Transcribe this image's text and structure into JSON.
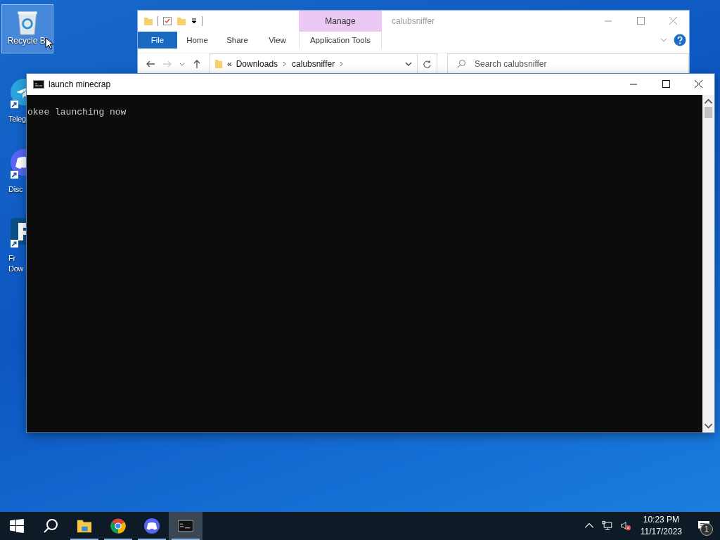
{
  "desktop_icons": [
    {
      "kind": "recycle",
      "lines": [
        "Recycle Bi"
      ],
      "selected": true
    },
    {
      "kind": "telegram",
      "lines": [
        "Teleg"
      ],
      "selected": false
    },
    {
      "kind": "discord",
      "lines": [
        "Disc"
      ],
      "selected": false
    },
    {
      "kind": "letter-app",
      "lines": [
        "Fr",
        "Dow"
      ],
      "selected": false
    }
  ],
  "explorer": {
    "title": "calubsniffer",
    "context_tab": "Manage",
    "ribbon_tabs": [
      {
        "label": "File",
        "kind": "file"
      },
      {
        "label": "Home",
        "kind": "plain"
      },
      {
        "label": "Share",
        "kind": "plain"
      },
      {
        "label": "View",
        "kind": "plain"
      },
      {
        "label": "Application Tools",
        "kind": "context"
      }
    ],
    "address": {
      "overflow": "«",
      "crumbs": [
        "Downloads",
        "calubsniffer"
      ]
    },
    "search": {
      "placeholder": "Search calubsniffer"
    }
  },
  "console": {
    "title": "launch minecrap",
    "lines": [
      "okee launching now"
    ]
  },
  "taskbar": {
    "apps": [
      {
        "kind": "start",
        "running": false,
        "selected": false
      },
      {
        "kind": "search",
        "running": false,
        "selected": false
      },
      {
        "kind": "explorer",
        "running": true,
        "selected": false
      },
      {
        "kind": "chrome",
        "running": true,
        "selected": false
      },
      {
        "kind": "discord",
        "running": true,
        "selected": false
      },
      {
        "kind": "console",
        "running": true,
        "selected": true
      }
    ],
    "time": "10:23 PM",
    "date": "11/17/2023",
    "notifications": "1"
  }
}
